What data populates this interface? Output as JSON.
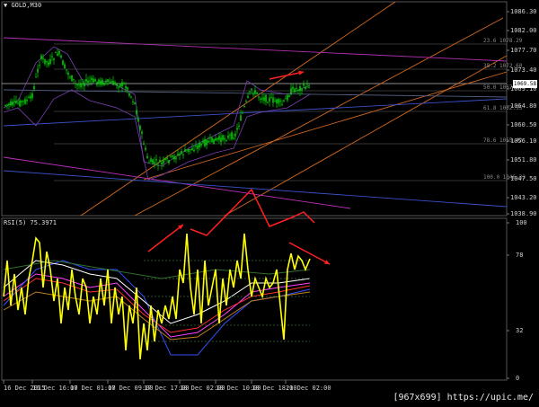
{
  "window": {
    "symbol_title": "GOLD,M30",
    "menu_arrow": "triangle-down-icon"
  },
  "price_axis": {
    "labels": [
      "1086.30",
      "1082.00",
      "1077.70",
      "1073.40",
      "1069.10",
      "1064.80",
      "1060.50",
      "1056.10",
      "1051.80",
      "1047.50",
      "1043.20",
      "1038.90"
    ],
    "current_price": "1069.58"
  },
  "fib_levels": [
    "23.6 1078.29",
    "38.2 1072.60",
    "50.0 1067.97",
    "61.8 1062.55",
    "78.6 1055.42",
    "100.0 1046.33"
  ],
  "rsi": {
    "title": "RSI(5) 75.3971",
    "axis_labels": [
      "100",
      "78",
      "32",
      "0"
    ]
  },
  "time_axis": {
    "labels": [
      "16 Dec 2015",
      "16 Dec 16:00",
      "17 Dec 01:00",
      "17 Dec 09:00",
      "17 Dec 17:00",
      "18 Dec 02:00",
      "18 Dec 10:00",
      "18 Dec 18:00",
      "21 Dec 02:00"
    ]
  },
  "watermark": "[967x699] https://upic.me/",
  "colors": {
    "background": "#000000",
    "candles": "#00d000",
    "rsi_line": "#ffff00",
    "annotation_arrow": "#ff2020",
    "channel_lines": "#d2691e",
    "trend_lines": "#c030c0"
  }
}
